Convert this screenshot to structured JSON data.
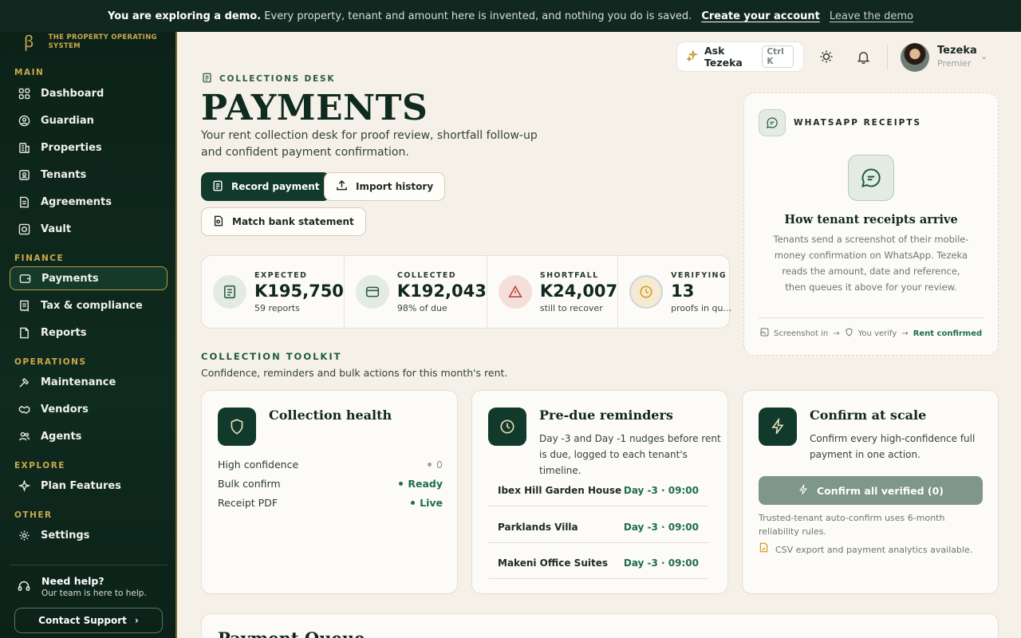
{
  "banner": {
    "lead": "You are exploring a demo.",
    "text": "Every property, tenant and amount here is invented, and nothing you do is saved.",
    "create": "Create your account",
    "leave": "Leave the demo"
  },
  "brand": {
    "tagline_1": "THE PROPERTY OPERATING",
    "tagline_2": "SYSTEM"
  },
  "sidebar": {
    "sections": {
      "main": "MAIN",
      "finance": "FINANCE",
      "operations": "OPERATIONS",
      "explore": "EXPLORE",
      "other": "OTHER"
    },
    "items": {
      "dashboard": "Dashboard",
      "guardian": "Guardian",
      "properties": "Properties",
      "tenants": "Tenants",
      "agreements": "Agreements",
      "vault": "Vault",
      "payments": "Payments",
      "tax": "Tax & compliance",
      "reports": "Reports",
      "maintenance": "Maintenance",
      "vendors": "Vendors",
      "agents": "Agents",
      "plan": "Plan Features",
      "settings": "Settings"
    },
    "help": {
      "title": "Need help?",
      "sub": "Our team is here to help.",
      "button": "Contact Support"
    }
  },
  "topbar": {
    "ask_label": "Ask Tezeka",
    "ask_shortcut": "Ctrl K",
    "user_name": "Tezeka",
    "user_plan": "Premier"
  },
  "header": {
    "kicker": "COLLECTIONS DESK",
    "title": "PAYMENTS",
    "subtitle": "Your rent collection desk for proof review, shortfall follow-up and confident payment confirmation.",
    "actions": {
      "record": "Record payment",
      "import": "Import history",
      "match": "Match bank statement"
    }
  },
  "stats": [
    {
      "label": "EXPECTED",
      "value": "K195,750",
      "sub": "59 reports",
      "icon": "document-icon"
    },
    {
      "label": "COLLECTED",
      "value": "K192,043",
      "sub": "98% of due",
      "icon": "wallet-icon"
    },
    {
      "label": "SHORTFALL",
      "value": "K24,007",
      "sub": "still to recover",
      "icon": "alert-icon"
    },
    {
      "label": "VERIFYING",
      "value": "13",
      "sub": "proofs in queue",
      "icon": "clock-icon"
    }
  ],
  "toolkit": {
    "title": "COLLECTION TOOLKIT",
    "subtitle": "Confidence, reminders and bulk actions for this month's rent.",
    "health": {
      "title": "Collection health",
      "rows": [
        {
          "label": "High confidence",
          "value": "0"
        },
        {
          "label": "Bulk confirm",
          "value": "Ready"
        },
        {
          "label": "Receipt PDF",
          "value": "Live"
        }
      ]
    },
    "reminders": {
      "title": "Pre-due reminders",
      "desc": "Day -3 and Day -1 nudges before rent is due, logged to each tenant's timeline.",
      "rows": [
        {
          "property": "Ibex Hill Garden House",
          "when": "Day -3 · 09:00"
        },
        {
          "property": "Parklands Villa",
          "when": "Day -3 · 09:00"
        },
        {
          "property": "Makeni Office Suites",
          "when": "Day -3 · 09:00"
        }
      ]
    },
    "confirm": {
      "title": "Confirm at scale",
      "desc": "Confirm every high-confidence full payment in one action.",
      "button": "Confirm all verified (0)",
      "note": "Trusted-tenant auto-confirm uses 6-month reliability rules.",
      "note2": "CSV export and payment analytics available."
    }
  },
  "whatsapp": {
    "header": "WHATSAPP RECEIPTS",
    "title": "How tenant receipts arrive",
    "desc": "Tenants send a screenshot of their mobile-money confirmation on WhatsApp. Tezeka reads the amount, date and reference, then queues it above for your review.",
    "flow": [
      "Screenshot in",
      "You verify",
      "Rent confirmed"
    ]
  },
  "queue": {
    "title": "Payment Queue"
  },
  "colors": {
    "brand_dark": "#123a2c",
    "accent_gold": "#c9a94c",
    "success": "#1f6e4a",
    "danger": "#c0443a",
    "warning": "#d49a2a"
  }
}
